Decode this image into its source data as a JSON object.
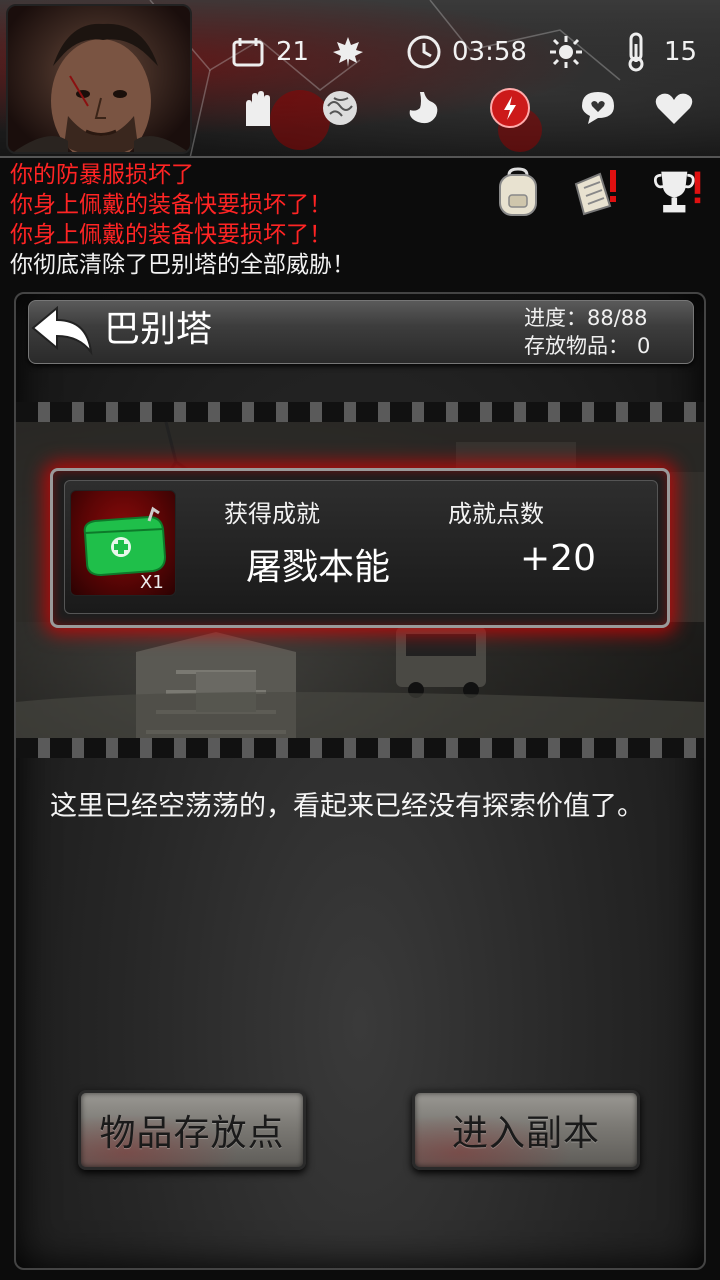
{
  "status": {
    "day": "21",
    "time": "03:58",
    "temperature": "15"
  },
  "log": [
    {
      "text": "你的防暴服损坏了",
      "color": "red"
    },
    {
      "text": "你身上佩戴的装备快要损坏了！",
      "color": "red"
    },
    {
      "text": "你身上佩戴的装备快要损坏了！",
      "color": "red"
    },
    {
      "text": "你彻底清除了巴别塔的全部威胁！",
      "color": "white"
    }
  ],
  "location": {
    "name": "巴别塔",
    "progress_label": "进度：",
    "progress_value": "88/88",
    "stored_label": "存放物品：",
    "stored_value": "0"
  },
  "achievement": {
    "obtained_label": "获得成就",
    "points_label": "成就点数",
    "name": "屠戮本能",
    "points": "+20",
    "item_count": "X1"
  },
  "description": "这里已经空荡荡的，看起来已经没有探索价值了。",
  "buttons": {
    "storage": "物品存放点",
    "enter_dungeon": "进入副本"
  },
  "colors": {
    "log_red": "#ff2424",
    "glow_red": "#dd0000"
  }
}
